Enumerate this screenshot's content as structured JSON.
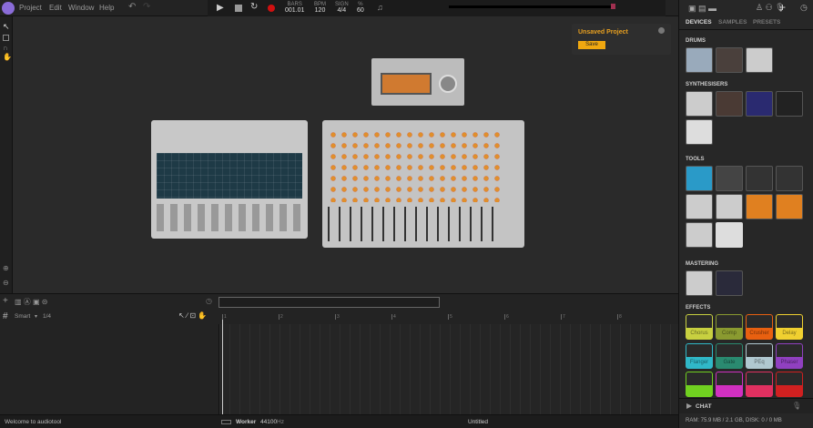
{
  "menu": {
    "items": [
      "Project",
      "Edit",
      "Window",
      "Help"
    ]
  },
  "transport": {
    "bars_label": "BARS",
    "bars": "001.01",
    "bpm_label": "BPM",
    "bpm": "120",
    "sign_label": "SIGN",
    "sign": "4/4",
    "pct_label": "%",
    "pct": "60"
  },
  "notice": {
    "title": "Unsaved Project",
    "save": "Save"
  },
  "right": {
    "tabs": [
      "DEVICES",
      "SAMPLES",
      "PRESETS"
    ],
    "sections": {
      "drums": "DRUMS",
      "synths": "SYNTHESISERS",
      "tools": "TOOLS",
      "mastering": "MASTERING",
      "effects": "EFFECTS"
    },
    "effects": [
      {
        "label": "Chorus",
        "color": "#c8d040"
      },
      {
        "label": "Comp",
        "color": "#8a9a30"
      },
      {
        "label": "Crusher",
        "color": "#e86010"
      },
      {
        "label": "Delay",
        "color": "#f0d030"
      },
      {
        "label": "Flanger",
        "color": "#30b8c8"
      },
      {
        "label": "Gate",
        "color": "#2a8a70"
      },
      {
        "label": "PEq",
        "color": "#b0c8d0"
      },
      {
        "label": "Phaser",
        "color": "#9040c0"
      },
      {
        "label": "",
        "color": "#70d020"
      },
      {
        "label": "",
        "color": "#d030c0"
      },
      {
        "label": "",
        "color": "#e03060"
      },
      {
        "label": "",
        "color": "#d02020"
      }
    ],
    "chat": "CHAT",
    "ram": "RAM: 75.9 MB / 2.1 GB, DISK: 0 / 0 MB"
  },
  "timeline": {
    "snap": "Smart",
    "grid": "1/4",
    "bars": [
      "1",
      "2",
      "3",
      "4",
      "5",
      "6",
      "7",
      "8"
    ]
  },
  "status": {
    "welcome": "Welcome to audiotool",
    "worker": "Worker",
    "rate": "44100",
    "rate_unit": "Hz",
    "project": "Untitled"
  }
}
